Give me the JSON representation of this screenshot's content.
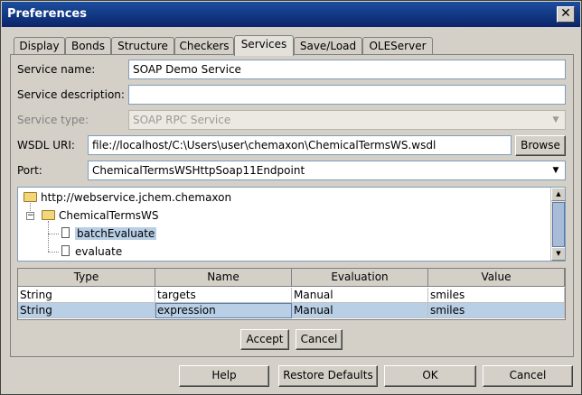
{
  "window": {
    "title": "Preferences",
    "close_glyph": "✕"
  },
  "tabs": [
    {
      "label": "Display",
      "active": false
    },
    {
      "label": "Bonds",
      "active": false
    },
    {
      "label": "Structure",
      "active": false
    },
    {
      "label": "Checkers",
      "active": false
    },
    {
      "label": "Services",
      "active": true
    },
    {
      "label": "Save/Load",
      "active": false
    },
    {
      "label": "OLEServer",
      "active": false
    }
  ],
  "form": {
    "service_name": {
      "label": "Service name:",
      "value": "SOAP Demo Service"
    },
    "service_description": {
      "label": "Service description:",
      "value": ""
    },
    "service_type": {
      "label": "Service type:",
      "value": "SOAP RPC Service",
      "disabled": true
    },
    "wsdl_uri": {
      "label": "WSDL URI:",
      "value": "file://localhost/C:\\Users\\user\\chemaxon\\ChemicalTermsWS.wsdl",
      "browse_label": "Browse"
    },
    "port": {
      "label": "Port:",
      "value": "ChemicalTermsWSHttpSoap11Endpoint"
    }
  },
  "tree": {
    "root": "http://webservice.jchem.chemaxon",
    "service": "ChemicalTermsWS",
    "methods": [
      {
        "label": "batchEvaluate",
        "selected": true
      },
      {
        "label": "evaluate",
        "selected": false
      }
    ]
  },
  "table": {
    "headers": [
      "Type",
      "Name",
      "Evaluation",
      "Value"
    ],
    "rows": [
      {
        "type": "String",
        "name": "targets",
        "evaluation": "Manual",
        "value": "smiles",
        "selected": false
      },
      {
        "type": "String",
        "name": "expression",
        "evaluation": "Manual",
        "value": "smiles",
        "selected": true
      }
    ]
  },
  "panel_buttons": {
    "accept": "Accept",
    "cancel": "Cancel"
  },
  "dialog_buttons": {
    "help": "Help",
    "restore_defaults": "Restore Defaults",
    "ok": "OK",
    "cancel": "Cancel"
  },
  "colors": {
    "selection": "#b8cfe5",
    "titlebar": "#0a246a",
    "dialog_bg": "#d4d0c8"
  }
}
